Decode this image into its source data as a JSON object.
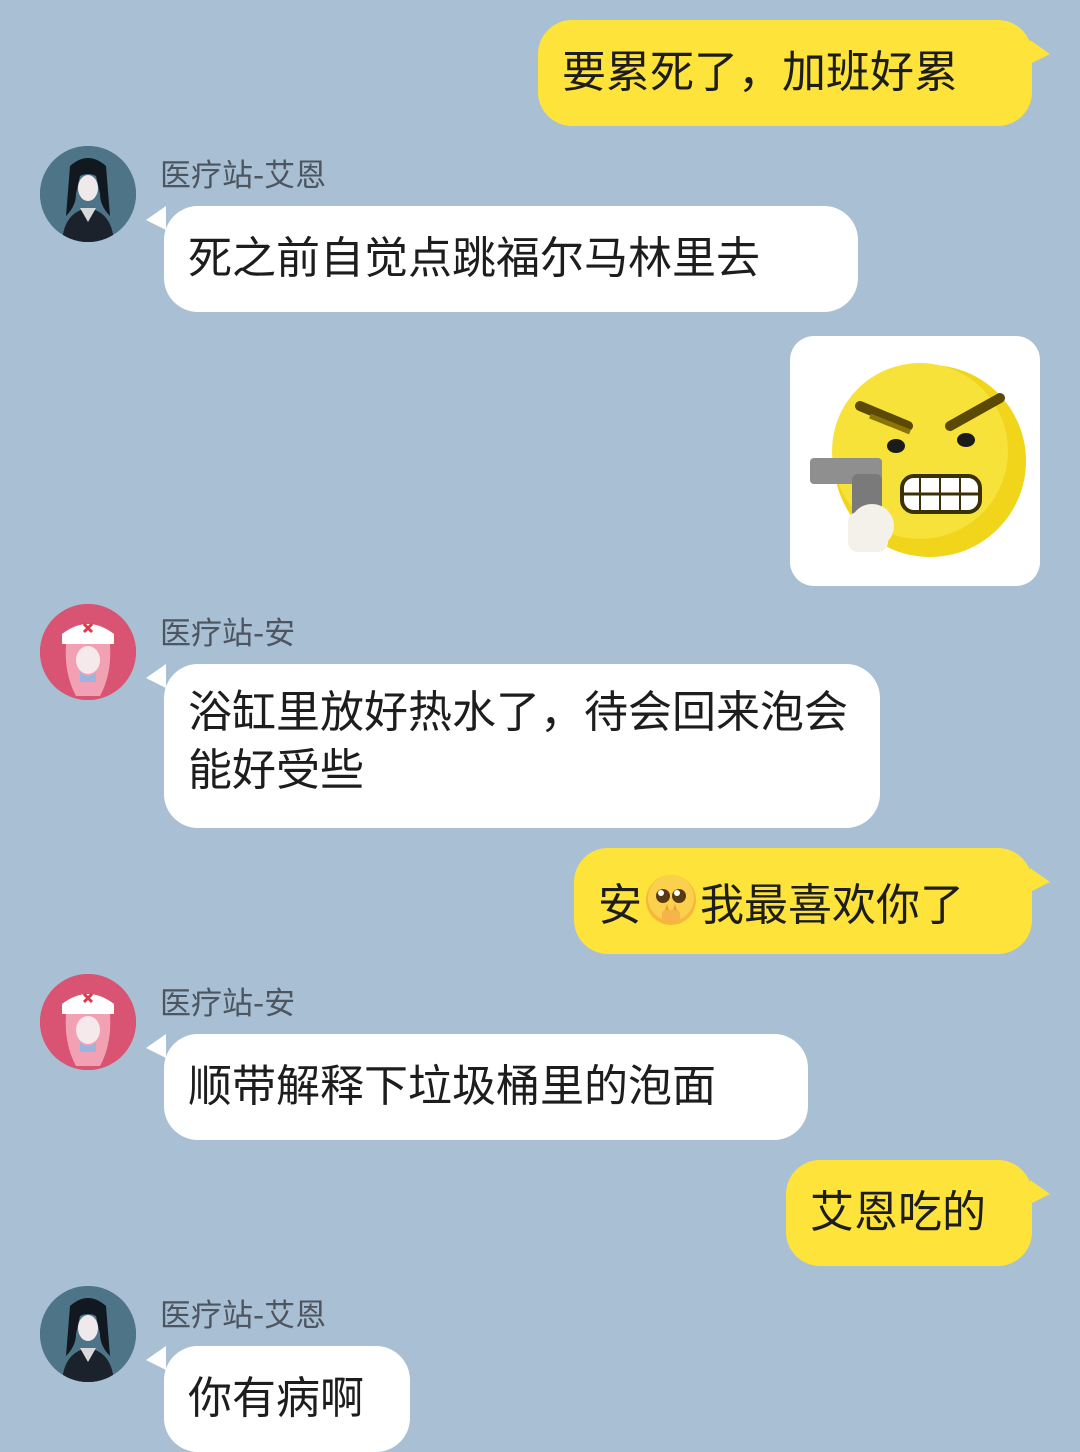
{
  "messages": [
    {
      "id": 1,
      "direction": "outgoing",
      "text": "要累死了，加班好累"
    },
    {
      "id": 2,
      "direction": "incoming",
      "sender": "医疗站-艾恩",
      "avatar": "ein-avatar",
      "text": "死之前自觉点跳福尔马林里去"
    },
    {
      "id": 3,
      "direction": "outgoing",
      "sticker": "angry-face-with-gun-sticker"
    },
    {
      "id": 4,
      "direction": "incoming",
      "sender": "医疗站-安",
      "avatar": "an-avatar",
      "text": "浴缸里放好热水了，待会回来泡会能好受些"
    },
    {
      "id": 5,
      "direction": "outgoing",
      "text_before": "安",
      "emoji": "pleading-face-emoji",
      "text_after": "我最喜欢你了"
    },
    {
      "id": 6,
      "direction": "incoming",
      "sender": "医疗站-安",
      "avatar": "an-avatar",
      "text": "顺带解释下垃圾桶里的泡面"
    },
    {
      "id": 7,
      "direction": "outgoing",
      "text": "艾恩吃的"
    },
    {
      "id": 8,
      "direction": "incoming",
      "sender": "医疗站-艾恩",
      "avatar": "ein-avatar",
      "text": "你有病啊"
    }
  ],
  "colors": {
    "background": "#a9bfd3",
    "outgoing_bubble": "#fde33a",
    "incoming_bubble": "#ffffff",
    "sender_name": "#4c5560"
  }
}
